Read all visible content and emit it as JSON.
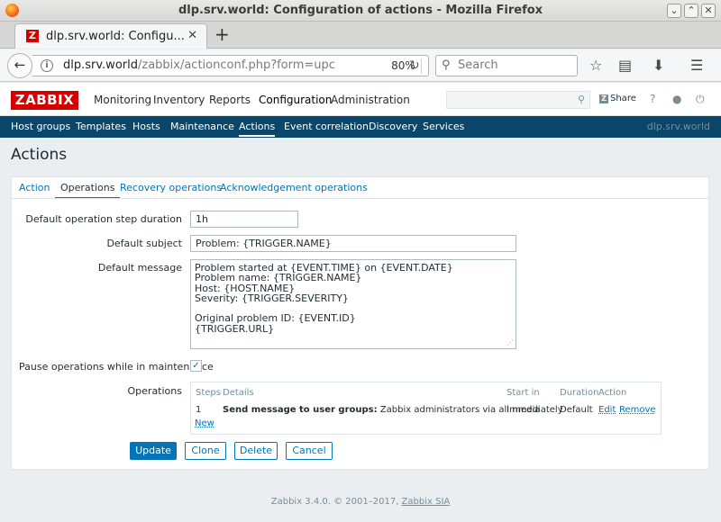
{
  "window": {
    "title": "dlp.srv.world: Configuration of actions - Mozilla Firefox",
    "minimize_glyph": "⌄",
    "maximize_glyph": "⌃",
    "close_glyph": "✕"
  },
  "browser": {
    "tab_title": "dlp.srv.world: Configu...",
    "tab_favicon_letter": "Z",
    "tab_close": "✕",
    "new_tab": "+",
    "url_host": "dlp.srv.world",
    "url_path": "/zabbix/actionconf.php?form=upc",
    "zoom": "80%",
    "search_placeholder": "Search",
    "icons": [
      "back-icon",
      "info-icon",
      "reload-icon",
      "search-icon",
      "bookmark-star-icon",
      "reading-list-icon",
      "download-icon",
      "hamburger-menu-icon"
    ]
  },
  "zabbix": {
    "logo": "ZABBIX",
    "main_menu": [
      "Monitoring",
      "Inventory",
      "Reports",
      "Configuration",
      "Administration"
    ],
    "share_label": "Share",
    "share_z": "Z",
    "header_icons": [
      "help-icon",
      "user-icon",
      "power-icon"
    ],
    "sub_menu": [
      "Host groups",
      "Templates",
      "Hosts",
      "Maintenance",
      "Actions",
      "Event correlation",
      "Discovery",
      "Services"
    ],
    "server_name": "dlp.srv.world",
    "accent_color": "#0275b8",
    "submenu_color": "#0a466a",
    "logo_color": "#d40000"
  },
  "page": {
    "title": "Actions",
    "tabs": [
      "Action",
      "Operations",
      "Recovery operations",
      "Acknowledgement operations"
    ],
    "active_tab": "Operations"
  },
  "form": {
    "step_duration_label": "Default operation step duration",
    "step_duration_value": "1h",
    "subject_label": "Default subject",
    "subject_value": "Problem: {TRIGGER.NAME}",
    "message_label": "Default message",
    "message_value": "Problem started at {EVENT.TIME} on {EVENT.DATE}\nProblem name: {TRIGGER.NAME}\nHost: {HOST.NAME}\nSeverity: {TRIGGER.SEVERITY}\n\nOriginal problem ID: {EVENT.ID}\n{TRIGGER.URL}",
    "pause_label": "Pause operations while in maintenance",
    "pause_checked": true,
    "operations_label": "Operations",
    "operations_table": {
      "headers": [
        "Steps",
        "Details",
        "Start in",
        "Duration",
        "Action"
      ],
      "rows": [
        {
          "steps": "1",
          "details_bold": "Send message to user groups:",
          "details_rest": " Zabbix administrators via all media",
          "start_in": "Immediately",
          "duration": "Default",
          "edit": "Edit",
          "remove": "Remove"
        }
      ],
      "new_link": "New"
    },
    "buttons": {
      "update": "Update",
      "clone": "Clone",
      "delete": "Delete",
      "cancel": "Cancel"
    }
  },
  "footer": {
    "text": "Zabbix 3.4.0. © 2001–2017, ",
    "link": "Zabbix SIA"
  }
}
